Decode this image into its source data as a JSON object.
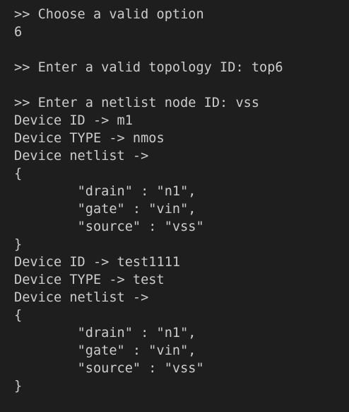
{
  "terminal": {
    "lines": [
      ">> Choose a valid option",
      "6",
      "",
      ">> Enter a valid topology ID: top6",
      "",
      ">> Enter a netlist node ID: vss",
      "Device ID -> m1",
      "Device TYPE -> nmos",
      "Device netlist ->",
      "{",
      "\t\"drain\" : \"n1\",",
      "\t\"gate\" : \"vin\",",
      "\t\"source\" : \"vss\"",
      "}",
      "Device ID -> test1111",
      "Device TYPE -> test",
      "Device netlist ->",
      "{",
      "\t\"drain\" : \"n1\",",
      "\t\"gate\" : \"vin\",",
      "\t\"source\" : \"vss\"",
      "}"
    ]
  },
  "colors": {
    "background": "#1e1e1e",
    "text": "#cccccc"
  }
}
